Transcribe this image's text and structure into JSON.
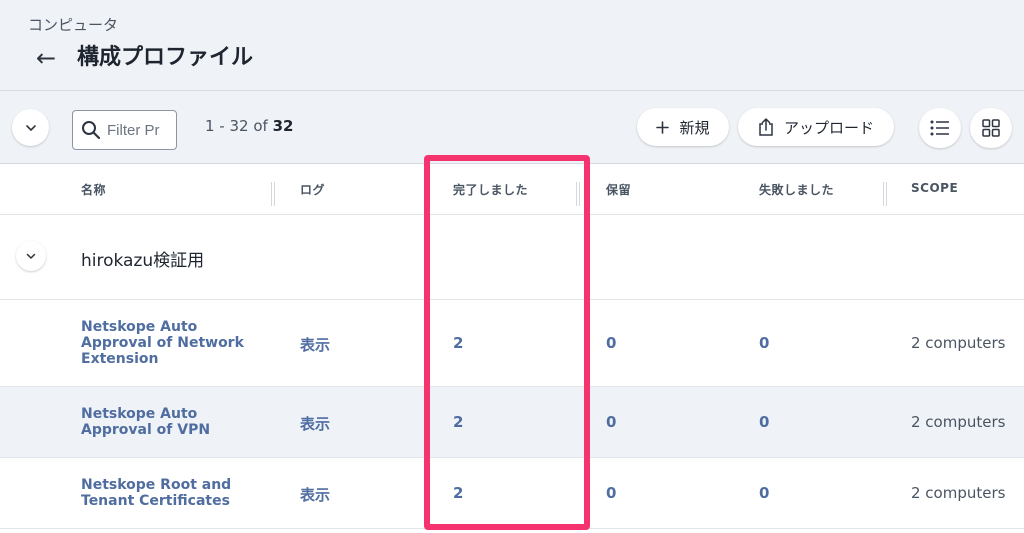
{
  "header": {
    "breadcrumb": "コンピュータ",
    "back_icon": "←",
    "title": "構成プロファイル"
  },
  "toolbar": {
    "filter_placeholder": "Filter Pr",
    "count_prefix": "1 - 32 of ",
    "count_total": "32",
    "new_label": "新規",
    "upload_label": "アップロード"
  },
  "columns": {
    "name": "名称",
    "log": "ログ",
    "completed": "完了しました",
    "pending": "保留",
    "failed": "失敗しました",
    "scope": "SCOPE"
  },
  "group": {
    "name": "hirokazu検証用"
  },
  "rows": [
    {
      "name": "Netskope Auto Approval of Network Extension",
      "log": "表示",
      "completed": "2",
      "pending": "0",
      "failed": "0",
      "scope": "2 computers"
    },
    {
      "name": "Netskope Auto Approval of VPN",
      "log": "表示",
      "completed": "2",
      "pending": "0",
      "failed": "0",
      "scope": "2 computers"
    },
    {
      "name": "Netskope Root and Tenant Certificates",
      "log": "表示",
      "completed": "2",
      "pending": "0",
      "failed": "0",
      "scope": "2 computers"
    }
  ],
  "colors": {
    "header_bg": "#eff2f6",
    "link": "#4f6da0",
    "highlight": "#f5336f",
    "alt_row": "#eff2f6"
  }
}
